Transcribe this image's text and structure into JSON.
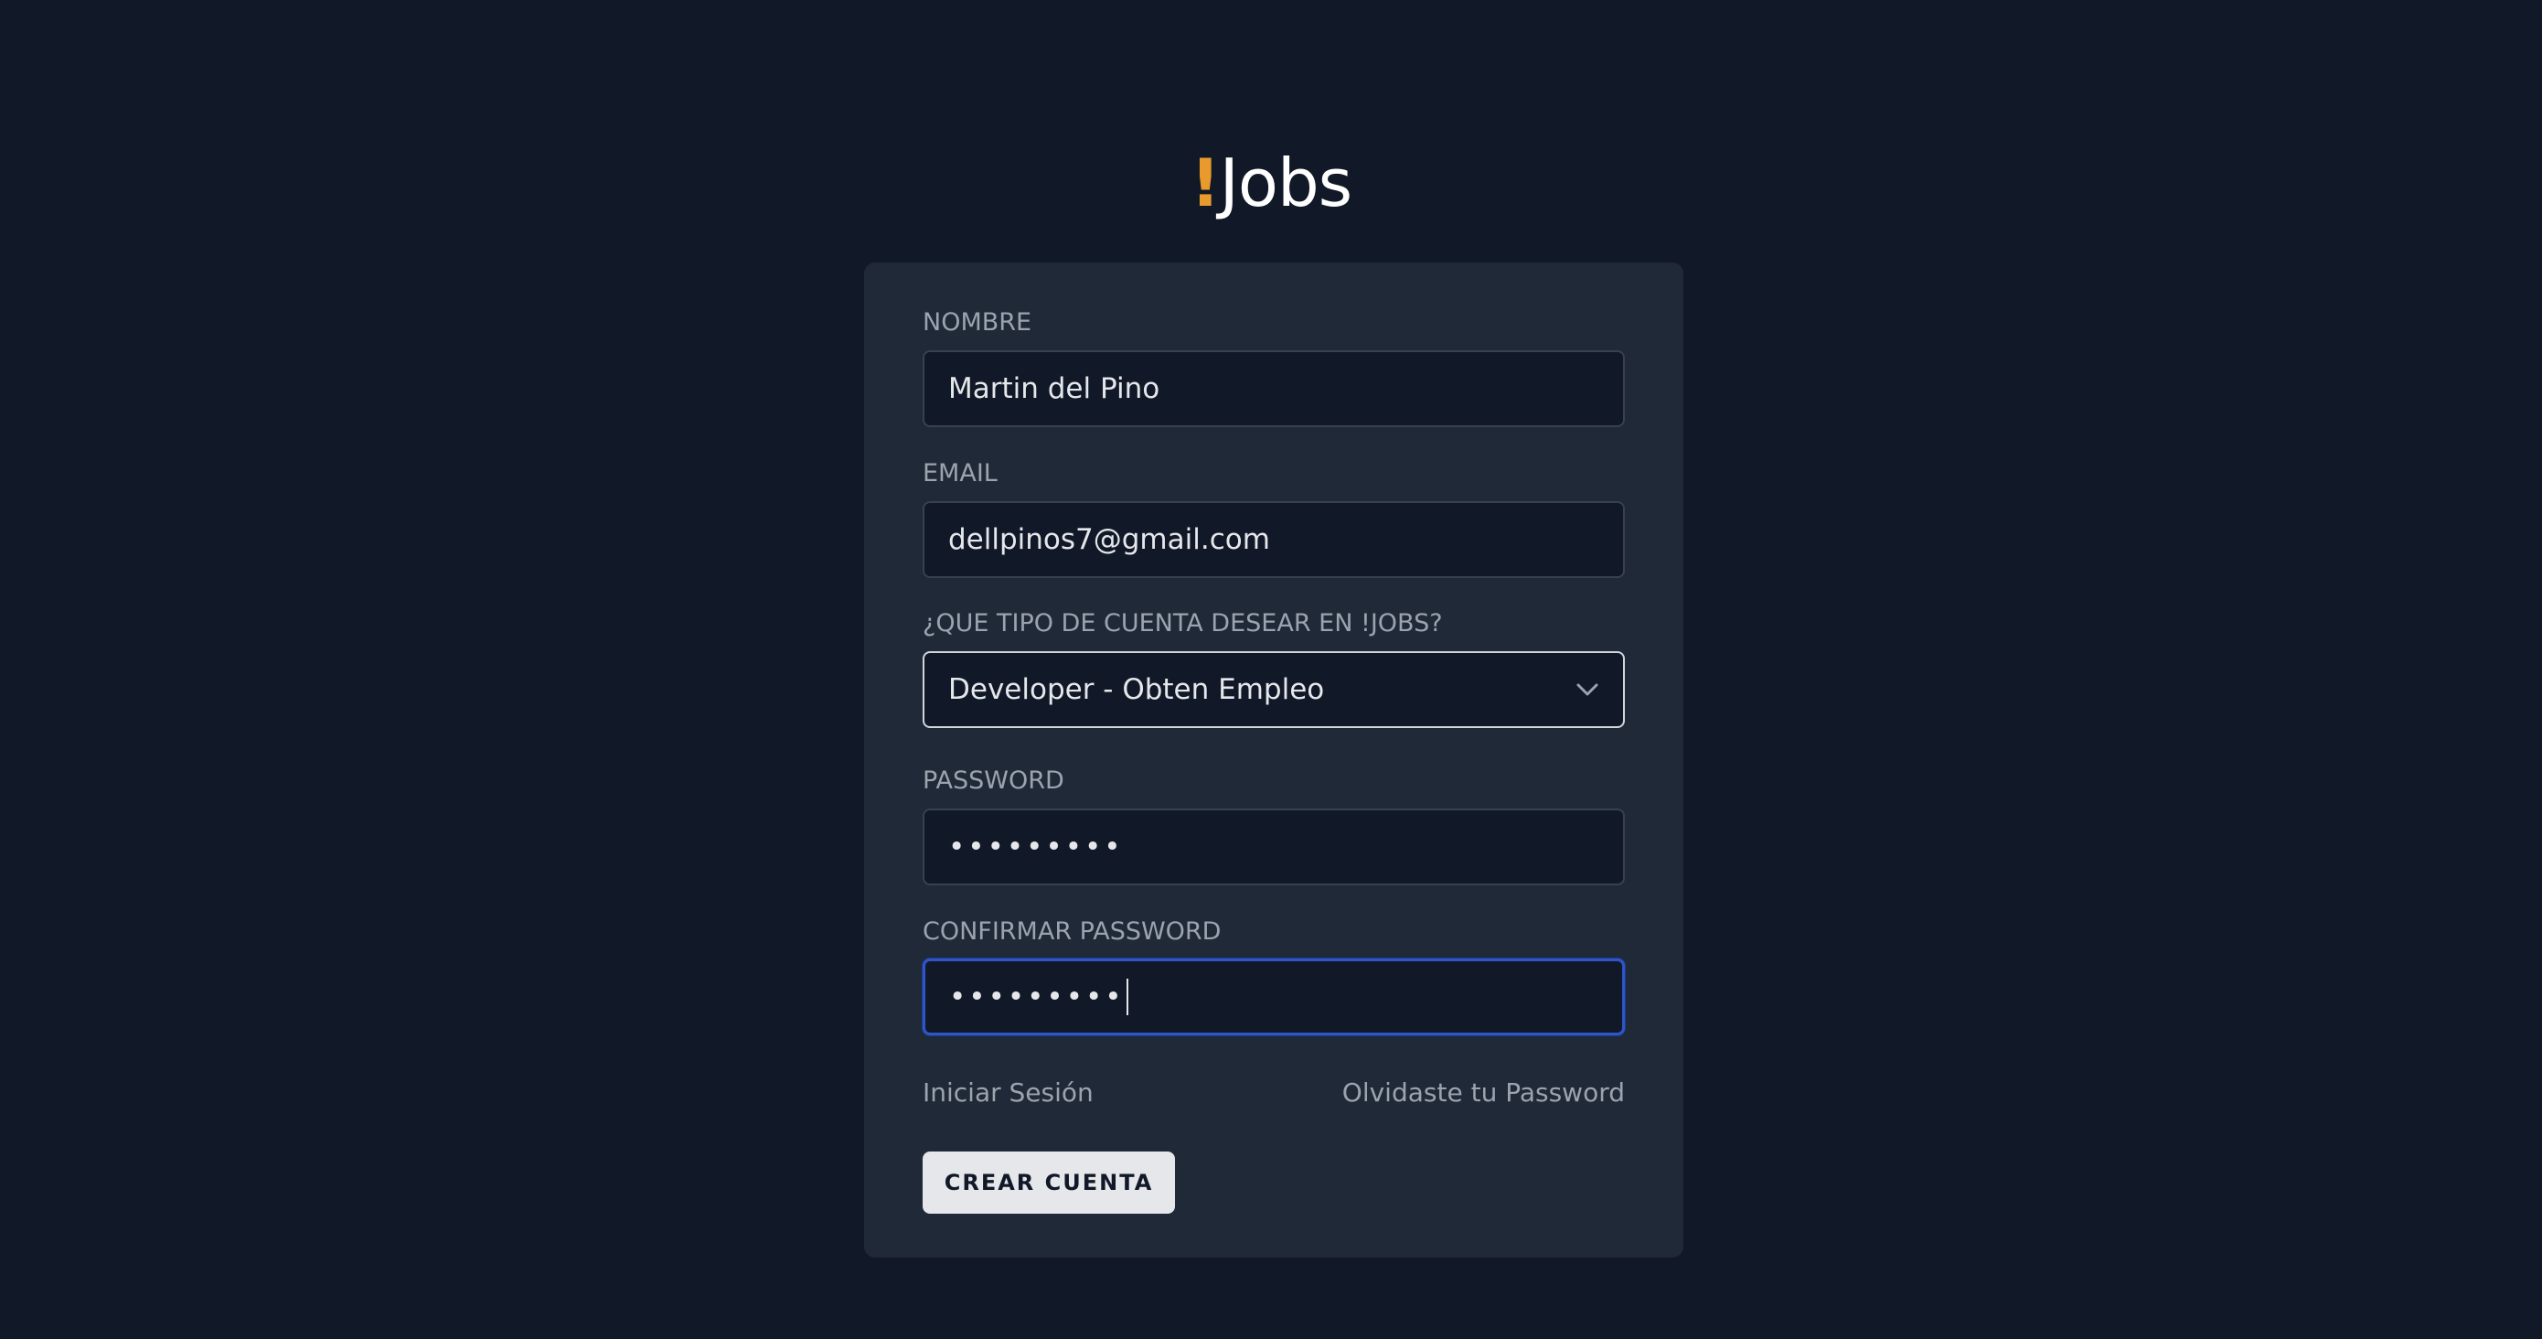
{
  "brand": {
    "mark": "!",
    "name": "Jobs",
    "accent_color": "#e89a2c"
  },
  "form": {
    "nombre": {
      "label": "NOMBRE",
      "value": "Martin del Pino"
    },
    "email": {
      "label": "EMAIL",
      "value": "dellpinos7@gmail.com"
    },
    "tipo_cuenta": {
      "label": "¿QUE TIPO DE CUENTA DESEAR EN !JOBS?",
      "selected": "Developer - Obten Empleo",
      "icon": "chevron-down-icon"
    },
    "password": {
      "label": "PASSWORD",
      "masked_value": "•••••••••"
    },
    "confirmar_password": {
      "label": "CONFIRMAR PASSWORD",
      "masked_value": "•••••••••",
      "focused": true
    }
  },
  "links": {
    "login": "Iniciar Sesión",
    "forgot": "Olvidaste tu Password"
  },
  "submit": {
    "label": "CREAR CUENTA"
  },
  "colors": {
    "background": "#111827",
    "card": "#1f2937",
    "focus_border": "#2f56c8"
  }
}
